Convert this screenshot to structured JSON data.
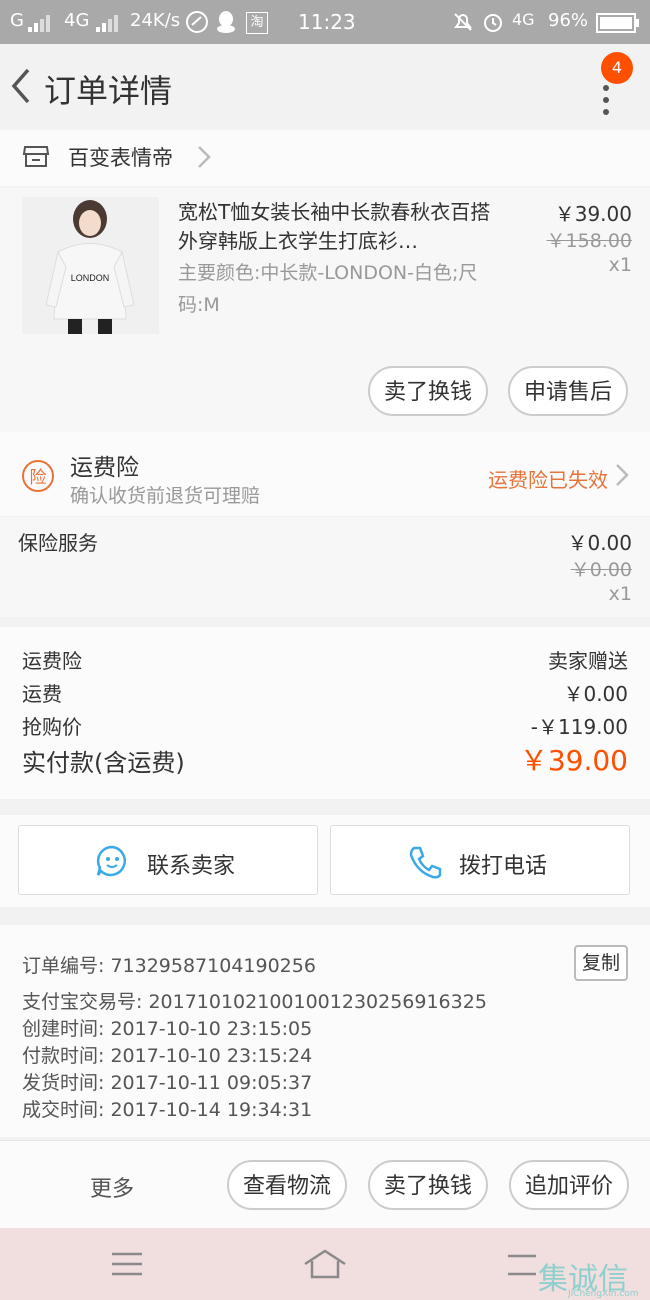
{
  "status_bar": {
    "signal_left": "G",
    "network": "4G",
    "speed": "24K/s",
    "taobao_label": "淘",
    "time": "11:23",
    "network_right": "4G",
    "battery": "96%"
  },
  "header": {
    "title": "订单详情",
    "badge_count": "4"
  },
  "shop": {
    "name": "百变表情帝"
  },
  "product": {
    "title": "宽松T恤女装长袖中长款春秋衣百搭外穿韩版上衣学生打底衫…",
    "sku": "主要颜色:中长款-LONDON-白色;尺码:M",
    "price": "￥39.00",
    "original_price": "￥158.00",
    "quantity": "x1",
    "thumb_text": "LONDON",
    "actions": [
      "卖了换钱",
      "申请售后"
    ]
  },
  "insurance": {
    "icon_text": "险",
    "title": "运费险",
    "subtitle": "确认收货前退货可理赔",
    "status": "运费险已失效"
  },
  "service": {
    "label": "保险服务",
    "price": "￥0.00",
    "original_price": "￥0.00",
    "quantity": "x1"
  },
  "summary": {
    "rows": [
      {
        "label": "运费险",
        "value": "卖家赠送"
      },
      {
        "label": "运费",
        "value": "￥0.00"
      },
      {
        "label": "抢购价",
        "value": "-￥119.00"
      }
    ],
    "paid_label": "实付款(含运费)",
    "paid_value": "￥39.00"
  },
  "contact": {
    "seller": "联系卖家",
    "phone": "拨打电话"
  },
  "order_info": {
    "copy_label": "复制",
    "lines": [
      "订单编号: 71329587104190256",
      "支付宝交易号: 2017101021001001230256916325",
      "创建时间: 2017-10-10  23:15:05",
      "付款时间: 2017-10-10  23:15:24",
      "发货时间: 2017-10-11  09:05:37",
      "成交时间: 2017-10-14  19:34:31"
    ]
  },
  "bottom_actions": {
    "more": "更多",
    "buttons": [
      "查看物流",
      "卖了换钱",
      "追加评价"
    ]
  },
  "watermark": {
    "text": "集诚信",
    "sub": "JiChengXin.com"
  },
  "colors": {
    "accent": "#ff5000",
    "insurance": "#e8733a",
    "status_bar": "#a9a9a9",
    "nav_bar": "#f1dede"
  }
}
